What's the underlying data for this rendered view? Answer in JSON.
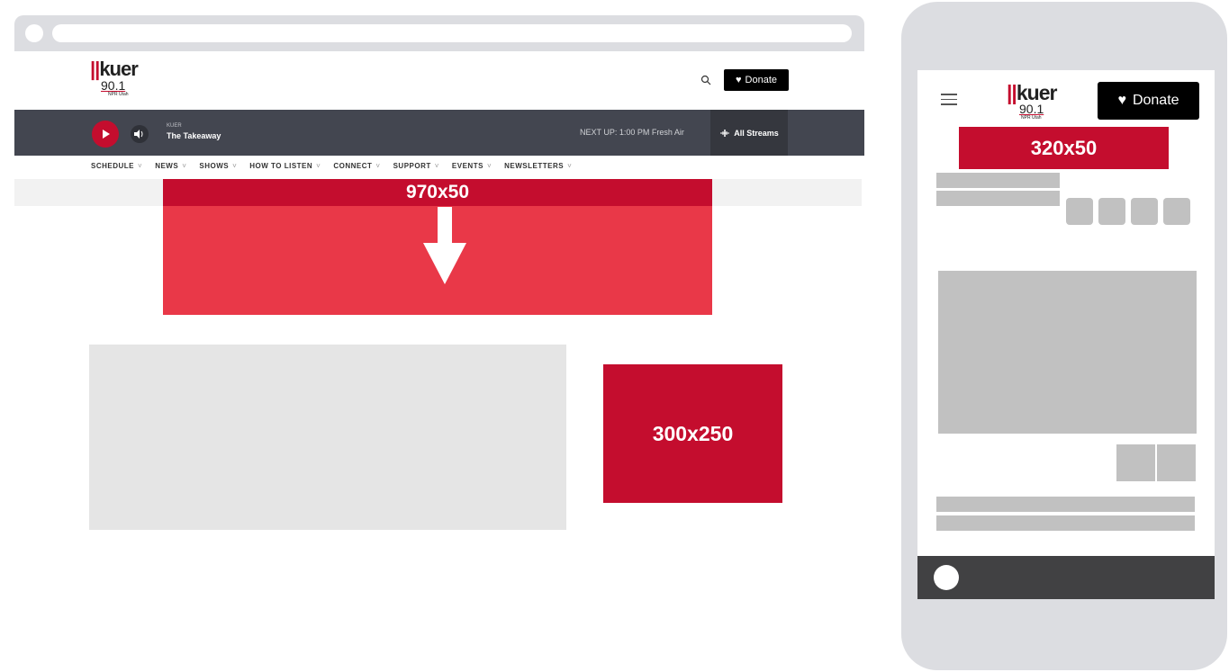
{
  "desktop": {
    "logo": {
      "bars": "||",
      "name": "kuer",
      "frequency": "90.1",
      "tagline": "NPR Utah"
    },
    "donate_label": "Donate",
    "player": {
      "station": "KUER",
      "show": "The Takeaway",
      "next_up": "NEXT UP: 1:00 PM Fresh Air",
      "streams_label": "All Streams"
    },
    "nav": [
      "SCHEDULE",
      "NEWS",
      "SHOWS",
      "HOW TO LISTEN",
      "CONNECT",
      "SUPPORT",
      "EVENTS",
      "NEWSLETTERS"
    ],
    "ads": {
      "leaderboard": "970x50",
      "rectangle": "300x250"
    }
  },
  "mobile": {
    "logo": {
      "bars": "||",
      "name": "kuer",
      "frequency": "90.1",
      "tagline": "NPR Utah"
    },
    "donate_label": "Donate",
    "ads": {
      "banner": "320x50"
    }
  },
  "colors": {
    "ad_red": "#c40d2e",
    "ad_expand": "#e93848",
    "player_bg": "#434650",
    "placeholder_gray": "#c1c1c1",
    "device_frame": "#dcdde1"
  }
}
